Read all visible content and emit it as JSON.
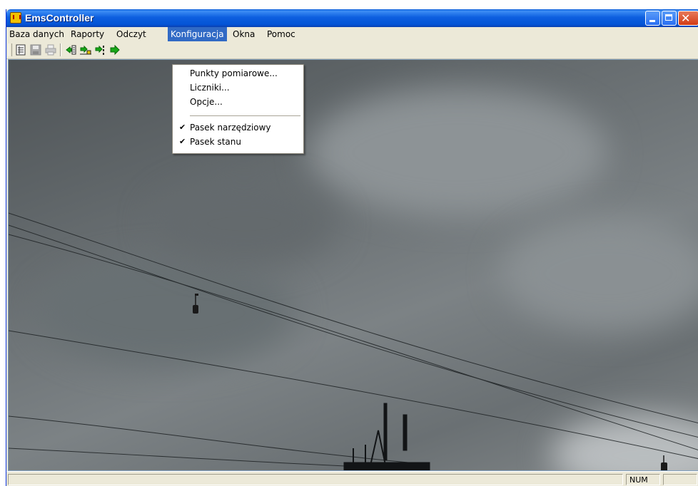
{
  "window": {
    "title": "EmsController",
    "controls": {
      "minimize": "minimize",
      "maximize": "maximize",
      "close": "✕"
    }
  },
  "menubar": {
    "items": [
      {
        "label": "Baza danych"
      },
      {
        "label": "Raporty"
      },
      {
        "label": "Odczyt"
      },
      {
        "label": "Konfiguracja",
        "active": true
      },
      {
        "label": "Okna"
      },
      {
        "label": "Pomoc"
      }
    ]
  },
  "dropdown": {
    "parent": "Konfiguracja",
    "items": [
      {
        "label": "Punkty pomiarowe...",
        "checked": false
      },
      {
        "label": "Liczniki...",
        "checked": false
      },
      {
        "label": "Opcje...",
        "checked": false
      },
      {
        "label": "Pasek narzędziowy",
        "checked": true
      },
      {
        "label": "Pasek stanu",
        "checked": true
      }
    ],
    "check_glyph": "✔"
  },
  "toolbar": {
    "icons": [
      "document-icon",
      "save-icon",
      "print-icon",
      "import-icon",
      "transfer-icon",
      "sync-icon",
      "next-icon"
    ]
  },
  "statusbar": {
    "num_indicator": "NUM"
  },
  "colors": {
    "accent": "#316ac5",
    "titlebar": "#0a5bd8",
    "chrome": "#ece9d8"
  }
}
